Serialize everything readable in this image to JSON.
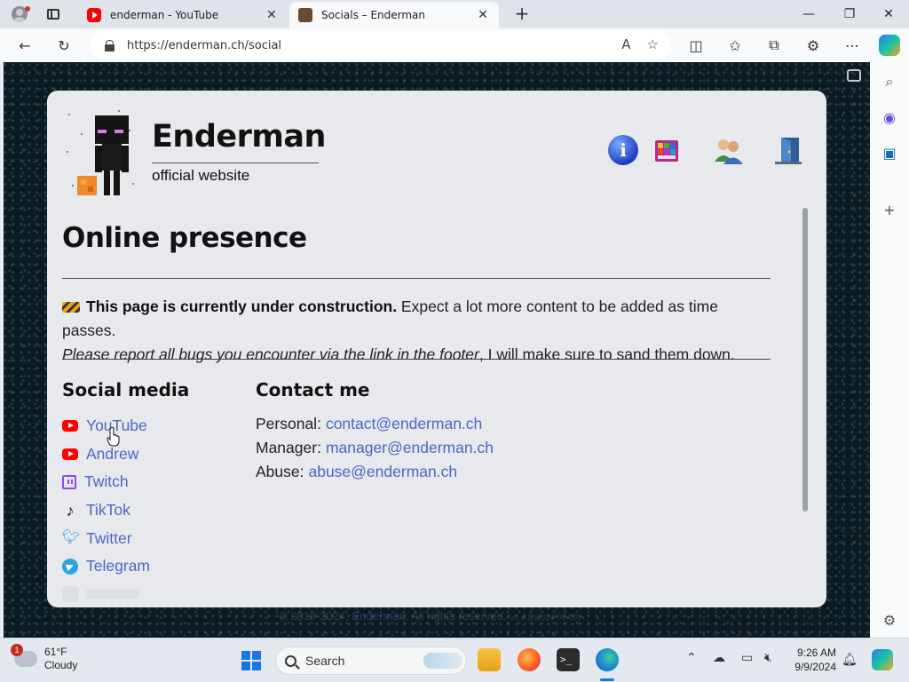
{
  "browser": {
    "tabs": [
      {
        "title": "enderman - YouTube",
        "active": false
      },
      {
        "title": "Socials – Enderman",
        "active": true
      }
    ],
    "address": "https://enderman.ch/social"
  },
  "site": {
    "title": "Enderman",
    "subtitle": "official website",
    "nav_icons": [
      "info-icon",
      "software-icon",
      "people-icon",
      "exit-door-icon"
    ]
  },
  "page": {
    "heading": "Online presence",
    "notice_bold": "This page is currently under construction.",
    "notice_rest": " Expect a lot more content to be added as time passes.",
    "notice_italic": "Please report all bugs you encounter via the link in the footer",
    "notice_end": ", I will make sure to sand them down."
  },
  "social": {
    "heading": "Social media",
    "links": [
      {
        "label": "YouTube",
        "icon": "youtube-icon"
      },
      {
        "label": "Andrew",
        "icon": "youtube-icon"
      },
      {
        "label": "Twitch",
        "icon": "twitch-icon"
      },
      {
        "label": "TikTok",
        "icon": "tiktok-icon"
      },
      {
        "label": "Twitter",
        "icon": "twitter-icon"
      },
      {
        "label": "Telegram",
        "icon": "telegram-icon"
      }
    ]
  },
  "contact": {
    "heading": "Contact me",
    "items": [
      {
        "label": "Personal:",
        "email": "contact@enderman.ch"
      },
      {
        "label": "Manager:",
        "email": "manager@enderman.ch"
      },
      {
        "label": "Abuse:",
        "email": "abuse@enderman.ch"
      }
    ]
  },
  "footer": {
    "copyright": "© 2018-2024,",
    "link": "Enderman",
    "rest": ". All rights reserved.",
    "version": "v0.3.8 (2024-09-09)"
  },
  "taskbar": {
    "weather_temp": "61°F",
    "weather_desc": "Cloudy",
    "weather_badge": "1",
    "search_placeholder": "Search",
    "time": "9:26 AM",
    "date": "9/9/2024"
  },
  "colors": {
    "link": "#4a68c5",
    "card": "#e7e9ec",
    "page_bg": "#0c1a22"
  }
}
